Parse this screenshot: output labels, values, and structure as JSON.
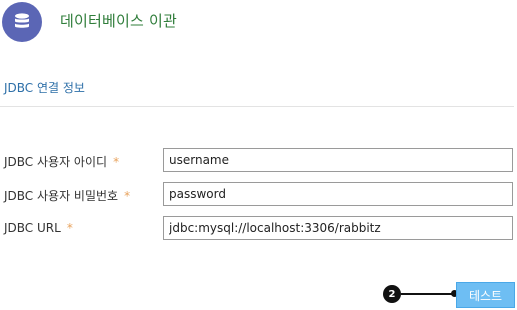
{
  "header": {
    "icon": "database-icon",
    "title": "데이터베이스 이관"
  },
  "section": {
    "label": "JDBC 연결 정보"
  },
  "form": {
    "required_marker": "*",
    "fields": [
      {
        "label": "JDBC 사용자 아이디",
        "value": "username",
        "required": true
      },
      {
        "label": "JDBC 사용자 비밀번호",
        "value": "password",
        "required": true
      },
      {
        "label": "JDBC URL",
        "value": "jdbc:mysql://localhost:3306/rabbitz",
        "required": true
      }
    ]
  },
  "footer": {
    "callout_number": "2",
    "test_button_label": "테스트"
  },
  "colors": {
    "header_icon_bg": "#5b66b5",
    "title_text": "#2f7d3a",
    "section_text": "#2d6fa8",
    "required_marker": "#e8a25c",
    "button_bg": "#6ebef3"
  }
}
